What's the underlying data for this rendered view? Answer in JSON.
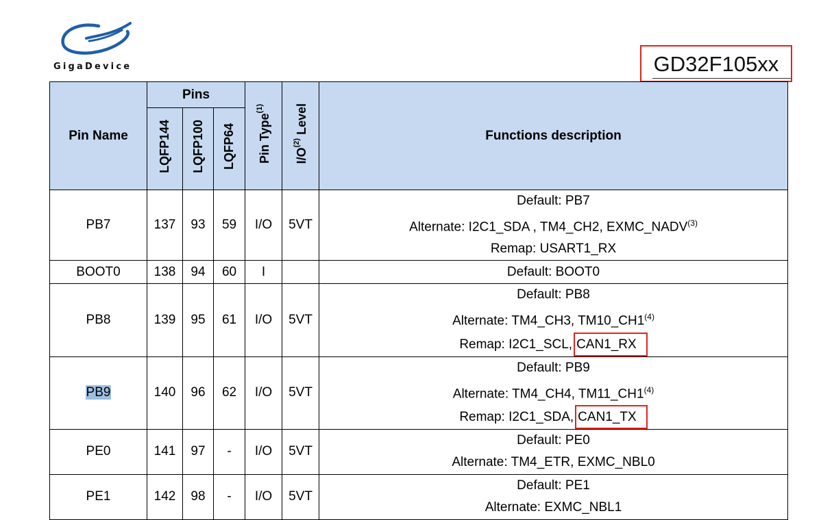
{
  "brand": {
    "logo_text": "GigaDevice"
  },
  "doc_title": "GD32F105xx",
  "table": {
    "headers": {
      "pin_name": "Pin Name",
      "pins": "Pins",
      "lqfp144": "LQFP144",
      "lqfp100": "LQFP100",
      "lqfp64": "LQFP64",
      "pin_type": "Pin Type",
      "pin_type_note": "(1)",
      "io_level_a": "I/O",
      "io_level_note": "(2)",
      "io_level_b": " Level",
      "functions": "Functions description"
    },
    "rows": [
      {
        "name": "PB7",
        "lqfp144": "137",
        "lqfp100": "93",
        "lqfp64": "59",
        "type": "I/O",
        "level": "5VT",
        "default": "Default: PB7",
        "alternate": "Alternate: I2C1_SDA , TM4_CH2, EXMC_NADV",
        "alternate_note": "(3)",
        "remap": "Remap: USART1_RX"
      },
      {
        "name": "BOOT0",
        "lqfp144": "138",
        "lqfp100": "94",
        "lqfp64": "60",
        "type": "I",
        "level": "",
        "default": "Default: BOOT0"
      },
      {
        "name": "PB8",
        "lqfp144": "139",
        "lqfp100": "95",
        "lqfp64": "61",
        "type": "I/O",
        "level": "5VT",
        "default": "Default: PB8",
        "alternate": "Alternate: TM4_CH3, TM10_CH1",
        "alternate_note": "(4)",
        "remap": "Remap: I2C1_SCL,",
        "remap_boxed": "CAN1_RX"
      },
      {
        "name": "PB9",
        "lqfp144": "140",
        "lqfp100": "96",
        "lqfp64": "62",
        "type": "I/O",
        "level": "5VT",
        "default": "Default: PB9",
        "alternate": "Alternate: TM4_CH4, TM11_CH1",
        "alternate_note": "(4)",
        "remap": "Remap: I2C1_SDA,",
        "remap_boxed": "CAN1_TX"
      },
      {
        "name": "PE0",
        "lqfp144": "141",
        "lqfp100": "97",
        "lqfp64": "-",
        "type": "I/O",
        "level": "5VT",
        "default": "Default: PE0",
        "alternate": "Alternate: TM4_ETR, EXMC_NBL0"
      },
      {
        "name": "PE1",
        "lqfp144": "142",
        "lqfp100": "98",
        "lqfp64": "-",
        "type": "I/O",
        "level": "5VT",
        "default": "Default: PE1",
        "alternate": "Alternate: EXMC_NBL1"
      }
    ]
  },
  "colors": {
    "header_bg": "#c6d9f1",
    "highlight_box": "#e2231a",
    "selection": "#9dbfe0",
    "logo_blue": "#1f5fa8"
  }
}
